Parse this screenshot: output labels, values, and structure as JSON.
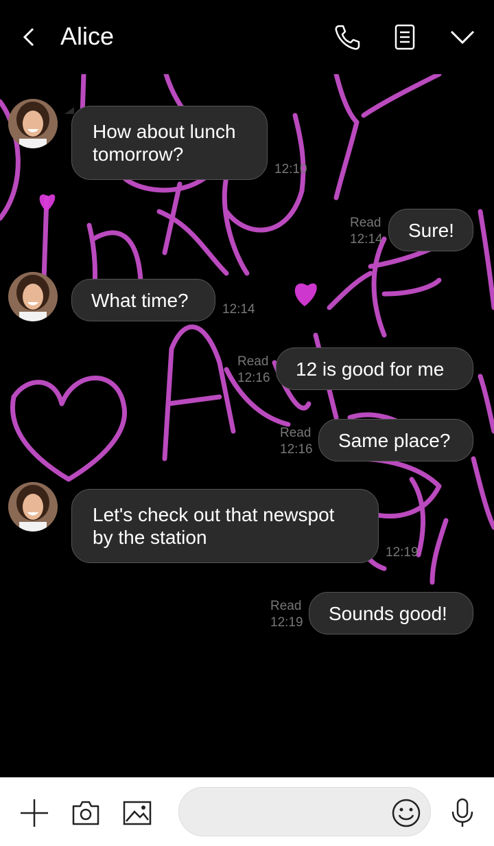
{
  "header": {
    "title": "Alice",
    "icons": [
      "back-arrow-icon",
      "phone-icon",
      "notes-icon",
      "chevron-down-icon"
    ]
  },
  "messages": [
    {
      "dir": "in",
      "text_line1": "How about lunch",
      "text_line2": "tomorrow?",
      "time": "12:10"
    },
    {
      "dir": "out",
      "text": "Sure!",
      "status": "Read",
      "time": "12:14"
    },
    {
      "dir": "in",
      "text": "What time?",
      "time": "12:14"
    },
    {
      "dir": "out",
      "text": "12 is good for me",
      "status": "Read",
      "time": "12:16"
    },
    {
      "dir": "out",
      "text": "Same place?",
      "status": "Read",
      "time": "12:16"
    },
    {
      "dir": "in",
      "text_line1": "Let's check out that newspot",
      "text_line2": "by the station",
      "time": "12:19"
    },
    {
      "dir": "out",
      "text": "Sounds good!",
      "status": "Read",
      "time": "12:19"
    }
  ],
  "bottom_bar": {
    "icons": [
      "plus-icon",
      "camera-icon",
      "image-icon",
      "emoji-icon",
      "microphone-icon"
    ],
    "input_placeholder": ""
  },
  "colors": {
    "background": "#000000",
    "bubble": "#2b2b2b",
    "doodle": "#c44fc9"
  }
}
